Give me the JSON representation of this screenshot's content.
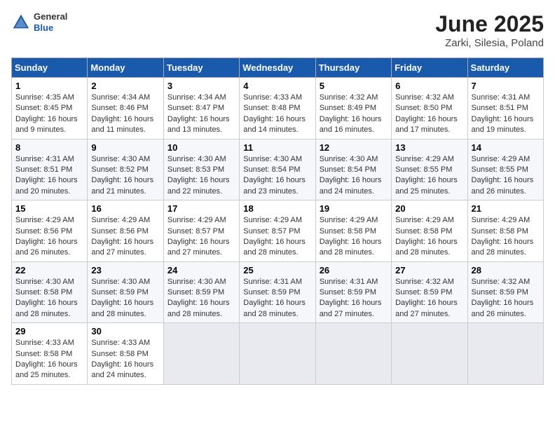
{
  "header": {
    "logo_general": "General",
    "logo_blue": "Blue",
    "title": "June 2025",
    "subtitle": "Zarki, Silesia, Poland"
  },
  "days_of_week": [
    "Sunday",
    "Monday",
    "Tuesday",
    "Wednesday",
    "Thursday",
    "Friday",
    "Saturday"
  ],
  "weeks": [
    [
      {
        "day": "1",
        "sunrise": "Sunrise: 4:35 AM",
        "sunset": "Sunset: 8:45 PM",
        "daylight": "Daylight: 16 hours and 9 minutes."
      },
      {
        "day": "2",
        "sunrise": "Sunrise: 4:34 AM",
        "sunset": "Sunset: 8:46 PM",
        "daylight": "Daylight: 16 hours and 11 minutes."
      },
      {
        "day": "3",
        "sunrise": "Sunrise: 4:34 AM",
        "sunset": "Sunset: 8:47 PM",
        "daylight": "Daylight: 16 hours and 13 minutes."
      },
      {
        "day": "4",
        "sunrise": "Sunrise: 4:33 AM",
        "sunset": "Sunset: 8:48 PM",
        "daylight": "Daylight: 16 hours and 14 minutes."
      },
      {
        "day": "5",
        "sunrise": "Sunrise: 4:32 AM",
        "sunset": "Sunset: 8:49 PM",
        "daylight": "Daylight: 16 hours and 16 minutes."
      },
      {
        "day": "6",
        "sunrise": "Sunrise: 4:32 AM",
        "sunset": "Sunset: 8:50 PM",
        "daylight": "Daylight: 16 hours and 17 minutes."
      },
      {
        "day": "7",
        "sunrise": "Sunrise: 4:31 AM",
        "sunset": "Sunset: 8:51 PM",
        "daylight": "Daylight: 16 hours and 19 minutes."
      }
    ],
    [
      {
        "day": "8",
        "sunrise": "Sunrise: 4:31 AM",
        "sunset": "Sunset: 8:51 PM",
        "daylight": "Daylight: 16 hours and 20 minutes."
      },
      {
        "day": "9",
        "sunrise": "Sunrise: 4:30 AM",
        "sunset": "Sunset: 8:52 PM",
        "daylight": "Daylight: 16 hours and 21 minutes."
      },
      {
        "day": "10",
        "sunrise": "Sunrise: 4:30 AM",
        "sunset": "Sunset: 8:53 PM",
        "daylight": "Daylight: 16 hours and 22 minutes."
      },
      {
        "day": "11",
        "sunrise": "Sunrise: 4:30 AM",
        "sunset": "Sunset: 8:54 PM",
        "daylight": "Daylight: 16 hours and 23 minutes."
      },
      {
        "day": "12",
        "sunrise": "Sunrise: 4:30 AM",
        "sunset": "Sunset: 8:54 PM",
        "daylight": "Daylight: 16 hours and 24 minutes."
      },
      {
        "day": "13",
        "sunrise": "Sunrise: 4:29 AM",
        "sunset": "Sunset: 8:55 PM",
        "daylight": "Daylight: 16 hours and 25 minutes."
      },
      {
        "day": "14",
        "sunrise": "Sunrise: 4:29 AM",
        "sunset": "Sunset: 8:55 PM",
        "daylight": "Daylight: 16 hours and 26 minutes."
      }
    ],
    [
      {
        "day": "15",
        "sunrise": "Sunrise: 4:29 AM",
        "sunset": "Sunset: 8:56 PM",
        "daylight": "Daylight: 16 hours and 26 minutes."
      },
      {
        "day": "16",
        "sunrise": "Sunrise: 4:29 AM",
        "sunset": "Sunset: 8:56 PM",
        "daylight": "Daylight: 16 hours and 27 minutes."
      },
      {
        "day": "17",
        "sunrise": "Sunrise: 4:29 AM",
        "sunset": "Sunset: 8:57 PM",
        "daylight": "Daylight: 16 hours and 27 minutes."
      },
      {
        "day": "18",
        "sunrise": "Sunrise: 4:29 AM",
        "sunset": "Sunset: 8:57 PM",
        "daylight": "Daylight: 16 hours and 28 minutes."
      },
      {
        "day": "19",
        "sunrise": "Sunrise: 4:29 AM",
        "sunset": "Sunset: 8:58 PM",
        "daylight": "Daylight: 16 hours and 28 minutes."
      },
      {
        "day": "20",
        "sunrise": "Sunrise: 4:29 AM",
        "sunset": "Sunset: 8:58 PM",
        "daylight": "Daylight: 16 hours and 28 minutes."
      },
      {
        "day": "21",
        "sunrise": "Sunrise: 4:29 AM",
        "sunset": "Sunset: 8:58 PM",
        "daylight": "Daylight: 16 hours and 28 minutes."
      }
    ],
    [
      {
        "day": "22",
        "sunrise": "Sunrise: 4:30 AM",
        "sunset": "Sunset: 8:58 PM",
        "daylight": "Daylight: 16 hours and 28 minutes."
      },
      {
        "day": "23",
        "sunrise": "Sunrise: 4:30 AM",
        "sunset": "Sunset: 8:59 PM",
        "daylight": "Daylight: 16 hours and 28 minutes."
      },
      {
        "day": "24",
        "sunrise": "Sunrise: 4:30 AM",
        "sunset": "Sunset: 8:59 PM",
        "daylight": "Daylight: 16 hours and 28 minutes."
      },
      {
        "day": "25",
        "sunrise": "Sunrise: 4:31 AM",
        "sunset": "Sunset: 8:59 PM",
        "daylight": "Daylight: 16 hours and 28 minutes."
      },
      {
        "day": "26",
        "sunrise": "Sunrise: 4:31 AM",
        "sunset": "Sunset: 8:59 PM",
        "daylight": "Daylight: 16 hours and 27 minutes."
      },
      {
        "day": "27",
        "sunrise": "Sunrise: 4:32 AM",
        "sunset": "Sunset: 8:59 PM",
        "daylight": "Daylight: 16 hours and 27 minutes."
      },
      {
        "day": "28",
        "sunrise": "Sunrise: 4:32 AM",
        "sunset": "Sunset: 8:59 PM",
        "daylight": "Daylight: 16 hours and 26 minutes."
      }
    ],
    [
      {
        "day": "29",
        "sunrise": "Sunrise: 4:33 AM",
        "sunset": "Sunset: 8:58 PM",
        "daylight": "Daylight: 16 hours and 25 minutes."
      },
      {
        "day": "30",
        "sunrise": "Sunrise: 4:33 AM",
        "sunset": "Sunset: 8:58 PM",
        "daylight": "Daylight: 16 hours and 24 minutes."
      },
      null,
      null,
      null,
      null,
      null
    ]
  ]
}
